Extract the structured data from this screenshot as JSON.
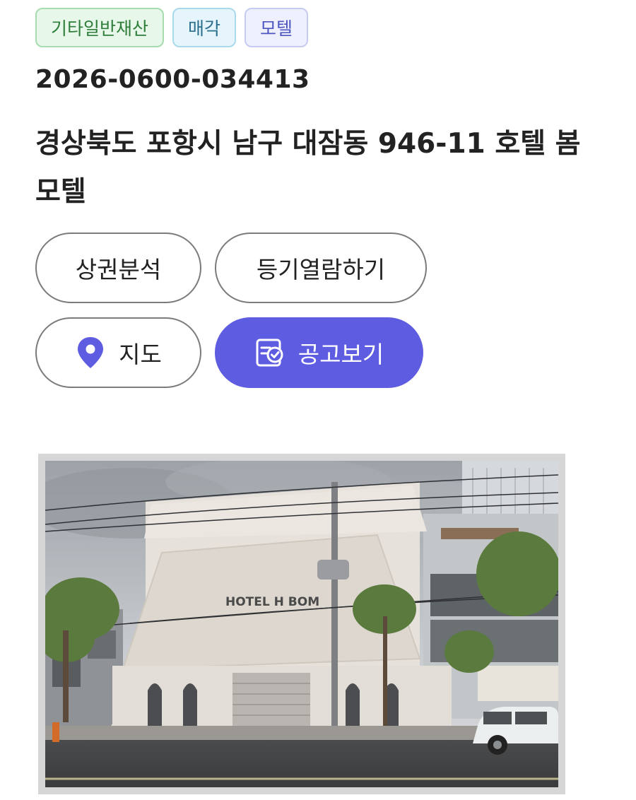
{
  "tags": [
    {
      "label": "기타일반재산",
      "color": "#2f7d3a"
    },
    {
      "label": "매각",
      "color": "#2a6f8d"
    },
    {
      "label": "모텔",
      "color": "#4d56c0"
    }
  ],
  "case_number": "2026-0600-034413",
  "address": "경상북도 포항시 남구 대잠동 946-11 호텔 봄 모텔",
  "buttons": {
    "commercial_analysis": "상권분석",
    "registry_view": "등기열람하기",
    "map": "지도",
    "notice_view": "공고보기"
  },
  "icons": {
    "map": "map-pin-icon",
    "notice": "document-check-icon"
  },
  "photo": {
    "signage": "HOTEL H BOM"
  },
  "colors": {
    "primary": "#5e5ce0",
    "pin": "#5e5ce0"
  }
}
